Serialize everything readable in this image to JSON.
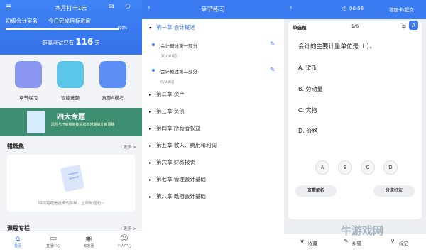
{
  "p1": {
    "title": "本月打卡1天",
    "mail_icon": "mail-icon",
    "user_icon": "user-icon",
    "menu_icon": "menu-icon",
    "subject": "初级会计实务",
    "today": "今日完成目标进度",
    "progress_label": "100%",
    "progress": 1.0,
    "exam_pre": "距离考试只有",
    "exam_days": "116",
    "exam_post": "天",
    "features": [
      {
        "label": "章节练习",
        "color": "#7c8ff0"
      },
      {
        "label": "智能选题",
        "color": "#5fc4e6"
      },
      {
        "label": "真题&模考",
        "color": "#5b8ff5"
      }
    ],
    "banner_title": "四大专题",
    "banner_sub": "风险与IT审核新技术和新时期审计新思路",
    "wrong_title": "错题集",
    "more": "更多 >",
    "wrong_msg": "回顾错题是进步的阶梯，立即做题吧~",
    "course_title": "课程专栏",
    "tabs": [
      {
        "label": "首页",
        "icon": "home-icon",
        "glyph": "⌂"
      },
      {
        "label": "直播中心",
        "icon": "tv-icon",
        "glyph": "▭"
      },
      {
        "label": "考友圈",
        "icon": "circle-icon",
        "glyph": "◉"
      },
      {
        "label": "个人中心",
        "icon": "person-icon",
        "glyph": "☺"
      }
    ]
  },
  "p2": {
    "title": "章节练习",
    "chapter1": "第一章 会计概述",
    "subs": [
      {
        "name": "会计概述第一部分",
        "count": "20/90道"
      },
      {
        "name": "会计概述第二部分",
        "count": "0/28道"
      }
    ],
    "chapters": [
      "第二章 资产",
      "第三章 负债",
      "第四章 所有者权益",
      "第五章 收入、费用和利润",
      "第六章 财务报表",
      "第七章 管理会计基础",
      "第八章 政府会计基础"
    ]
  },
  "p3": {
    "timer": "00:06",
    "answer_card": "答题卡/提交",
    "qtype": "单选题",
    "qnum": "1/6",
    "font_small": "中",
    "font_big": "A",
    "question": "会计的主要计量单位是（ ）。",
    "options": [
      "A. 货币",
      "B. 劳动量",
      "C. 实物",
      "D. 价格"
    ],
    "letters": [
      "A",
      "B",
      "C",
      "D"
    ],
    "view_analysis": "查看解析",
    "share": "分享好友",
    "collect": "收藏",
    "report": "纠错",
    "mark": "标记",
    "watermark": "牛游戏网"
  }
}
